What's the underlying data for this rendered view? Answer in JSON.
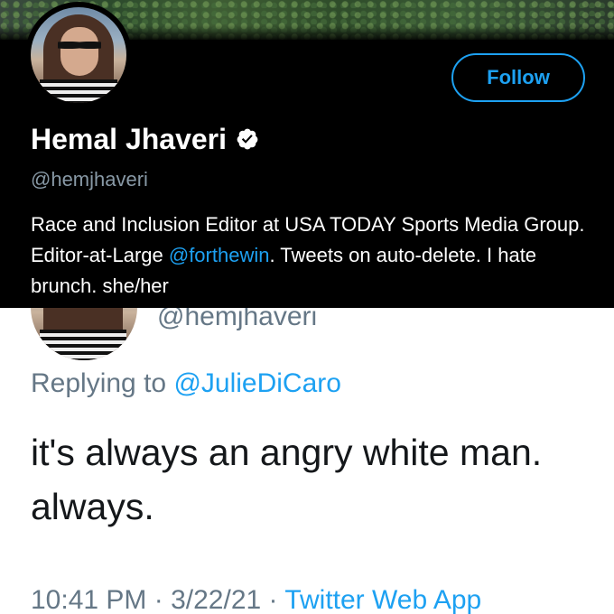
{
  "profile": {
    "display_name": "Hemal Jhaveri",
    "handle": "@hemjhaveri",
    "follow_label": "Follow",
    "verified_icon": "verified-badge-icon",
    "bio_part1": "Race and Inclusion Editor at USA TODAY Sports Media Group. Editor-at-Large ",
    "bio_mention": "@forthewin",
    "bio_part2": ". Tweets on auto-delete. I hate brunch. she/her"
  },
  "tweet": {
    "handle": "@hemjhaveri",
    "replying_prefix": "Replying to ",
    "replying_to": "@JulieDiCaro",
    "text": "it's always an angry white man. always.",
    "time": "10:41 PM",
    "separator1": " · ",
    "date": "3/22/21",
    "separator2": " · ",
    "source": "Twitter Web App"
  },
  "colors": {
    "accent": "#1da1f2",
    "dark_bg": "#000000",
    "muted": "#657786"
  }
}
